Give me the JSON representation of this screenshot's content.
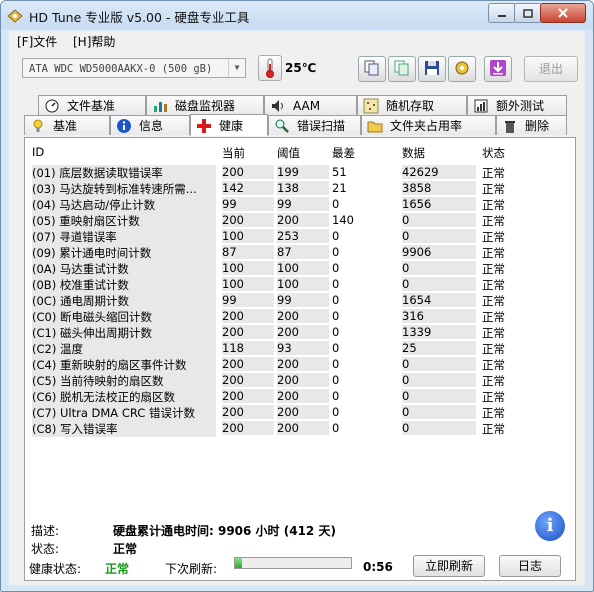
{
  "window": {
    "title": "HD Tune 专业版 v5.00 - 硬盘专业工具"
  },
  "menu": [
    {
      "label": "[F]文件"
    },
    {
      "label": "[H]帮助"
    }
  ],
  "toolbar": {
    "drive": "ATA    WDC WD5000AAKX-0 (500 gB)",
    "temperature": "25℃",
    "exit_label": "退出"
  },
  "tabs_row1": [
    {
      "label": "文件基准",
      "icon": "file-benchmark-icon"
    },
    {
      "label": "磁盘监视器",
      "icon": "disk-monitor-icon"
    },
    {
      "label": "AAM",
      "icon": "speaker-icon"
    },
    {
      "label": "随机存取",
      "icon": "random-access-icon"
    },
    {
      "label": "额外测试",
      "icon": "extra-tests-icon"
    }
  ],
  "tabs_row2": [
    {
      "label": "基准",
      "icon": "benchmark-icon"
    },
    {
      "label": "信息",
      "icon": "info-icon"
    },
    {
      "label": "健康",
      "icon": "health-cross-icon"
    },
    {
      "label": "错误扫描",
      "icon": "magnifier-icon"
    },
    {
      "label": "文件夹占用率",
      "icon": "folder-icon"
    },
    {
      "label": "删除",
      "icon": "trash-icon"
    }
  ],
  "table": {
    "headers": [
      "ID",
      "当前",
      "阈值",
      "最差",
      "数据",
      "状态"
    ],
    "rows": [
      {
        "id": "(01) 底层数据读取错误率",
        "current": "200",
        "threshold": "199",
        "worst": "51",
        "data": "42629",
        "status": "正常"
      },
      {
        "id": "(03) 马达旋转到标准转速所需...",
        "current": "142",
        "threshold": "138",
        "worst": "21",
        "data": "3858",
        "status": "正常"
      },
      {
        "id": "(04) 马达启动/停止计数",
        "current": "99",
        "threshold": "99",
        "worst": "0",
        "data": "1656",
        "status": "正常"
      },
      {
        "id": "(05) 重映射扇区计数",
        "current": "200",
        "threshold": "200",
        "worst": "140",
        "data": "0",
        "status": "正常"
      },
      {
        "id": "(07) 寻道错误率",
        "current": "100",
        "threshold": "253",
        "worst": "0",
        "data": "0",
        "status": "正常"
      },
      {
        "id": "(09) 累计通电时间计数",
        "current": "87",
        "threshold": "87",
        "worst": "0",
        "data": "9906",
        "status": "正常"
      },
      {
        "id": "(0A) 马达重试计数",
        "current": "100",
        "threshold": "100",
        "worst": "0",
        "data": "0",
        "status": "正常"
      },
      {
        "id": "(0B) 校准重试计数",
        "current": "100",
        "threshold": "100",
        "worst": "0",
        "data": "0",
        "status": "正常"
      },
      {
        "id": "(0C) 通电周期计数",
        "current": "99",
        "threshold": "99",
        "worst": "0",
        "data": "1654",
        "status": "正常"
      },
      {
        "id": "(C0) 断电磁头缩回计数",
        "current": "200",
        "threshold": "200",
        "worst": "0",
        "data": "316",
        "status": "正常"
      },
      {
        "id": "(C1) 磁头伸出周期计数",
        "current": "200",
        "threshold": "200",
        "worst": "0",
        "data": "1339",
        "status": "正常"
      },
      {
        "id": "(C2) 温度",
        "current": "118",
        "threshold": "93",
        "worst": "0",
        "data": "25",
        "status": "正常"
      },
      {
        "id": "(C4) 重新映射的扇区事件计数",
        "current": "200",
        "threshold": "200",
        "worst": "0",
        "data": "0",
        "status": "正常"
      },
      {
        "id": "(C5) 当前待映射的扇区数",
        "current": "200",
        "threshold": "200",
        "worst": "0",
        "data": "0",
        "status": "正常"
      },
      {
        "id": "(C6) 脱机无法校正的扇区数",
        "current": "200",
        "threshold": "200",
        "worst": "0",
        "data": "0",
        "status": "正常"
      },
      {
        "id": "(C7) Ultra DMA CRC 错误计数",
        "current": "200",
        "threshold": "200",
        "worst": "0",
        "data": "0",
        "status": "正常"
      },
      {
        "id": "(C8) 写入错误率",
        "current": "200",
        "threshold": "200",
        "worst": "0",
        "data": "0",
        "status": "正常"
      }
    ]
  },
  "details": {
    "desc_label": "描述:",
    "desc_value": "硬盘累计通电时间: 9906 小时 (412 天)",
    "status_label": "状态:",
    "status_value": "正常"
  },
  "footer": {
    "health_label": "健康状态:",
    "health_value": "正常",
    "next_refresh_label": "下次刷新:",
    "refresh_progress": 0.06,
    "countdown": "0:56",
    "refresh_now_label": "立即刷新",
    "log_label": "日志"
  }
}
